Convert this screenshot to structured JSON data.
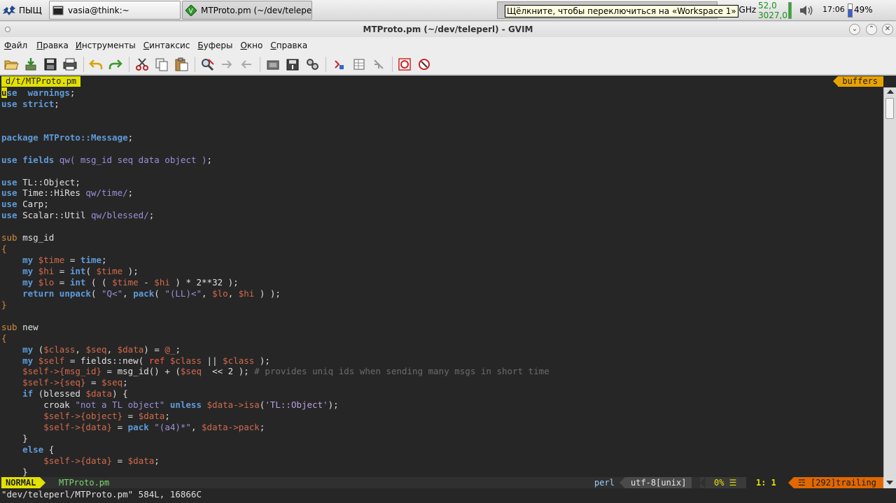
{
  "taskbar": {
    "start_label": "ПЫЩ",
    "tasks": [
      {
        "label": "vasia@think:~"
      },
      {
        "label": "MTProto.pm (~/dev/teleperl..."
      }
    ],
    "tooltip": "Щёлкните, чтобы переключиться на «Workspace 1»",
    "cpu_freq": "2,59 GHz",
    "temp1": "52,0",
    "temp2": "3027,0",
    "clock": "17:06",
    "battery": "49%",
    "battery_level": 0.49
  },
  "window": {
    "title": "MTProto.pm (~/dev/teleperl) - GVIM"
  },
  "menubar": {
    "items": [
      "Файл",
      "Правка",
      "Инструменты",
      "Синтаксис",
      "Буферы",
      "Окно",
      "Справка"
    ]
  },
  "toolbar": {
    "icons": [
      "open-icon",
      "save-icon",
      "save-all-icon",
      "print-icon",
      "undo-icon",
      "redo-icon",
      "cut-icon",
      "copy-icon",
      "paste-icon",
      "find-replace-icon",
      "find-next-icon",
      "find-prev-icon",
      "load-session-icon",
      "save-session-icon",
      "run-script-icon",
      "make-icon",
      "run-ctags-icon",
      "jump-tag-icon",
      "help-icon",
      "find-help-icon"
    ]
  },
  "editor": {
    "tab_file": "d/t/MTProto.pm",
    "tab_buffers": "buffers",
    "lines": [
      [
        [
          "kw",
          "use"
        ],
        [
          "",
          "  "
        ],
        [
          "kw",
          "warnings"
        ],
        [
          "",
          ";"
        ]
      ],
      [
        [
          "kw",
          "use"
        ],
        [
          "",
          ""
        ],
        [
          "kw",
          " strict"
        ],
        [
          "",
          ";"
        ]
      ],
      [],
      [],
      [
        [
          "kw",
          "package"
        ],
        [
          "kw",
          " MTProto::Message"
        ],
        [
          "",
          ";"
        ]
      ],
      [],
      [
        [
          "kw",
          "use"
        ],
        [
          "kw",
          " fields"
        ],
        [
          "",
          " "
        ],
        [
          "str",
          "qw("
        ],
        [
          "str",
          " msg_id seq data object "
        ],
        [
          "str",
          ")"
        ],
        [
          "",
          ";"
        ]
      ],
      [],
      [
        [
          "kw",
          "use"
        ],
        [
          "",
          " TL::Object;"
        ]
      ],
      [
        [
          "kw",
          "use"
        ],
        [
          "",
          " Time::HiRes "
        ],
        [
          "str",
          "qw/time/"
        ],
        [
          "",
          ";"
        ]
      ],
      [
        [
          "kw",
          "use"
        ],
        [
          "",
          " Carp;"
        ]
      ],
      [
        [
          "kw",
          "use"
        ],
        [
          "",
          " Scalar::Util "
        ],
        [
          "str",
          "qw/blessed/"
        ],
        [
          "",
          ";"
        ]
      ],
      [],
      [
        [
          "kw2",
          "sub"
        ],
        [
          "",
          " msg_id"
        ]
      ],
      [
        [
          "kw2",
          "{"
        ]
      ],
      [
        [
          "",
          "    "
        ],
        [
          "kw",
          "my"
        ],
        [
          "",
          " "
        ],
        [
          "var",
          "$time"
        ],
        [
          "",
          " = "
        ],
        [
          "kw",
          "time"
        ],
        [
          "",
          ";"
        ]
      ],
      [
        [
          "",
          "    "
        ],
        [
          "kw",
          "my"
        ],
        [
          "",
          " "
        ],
        [
          "var",
          "$hi"
        ],
        [
          "",
          " = "
        ],
        [
          "kw",
          "int"
        ],
        [
          "",
          "( "
        ],
        [
          "var",
          "$time"
        ],
        [
          "",
          " );"
        ]
      ],
      [
        [
          "",
          "    "
        ],
        [
          "kw",
          "my"
        ],
        [
          "",
          " "
        ],
        [
          "var",
          "$lo"
        ],
        [
          "",
          " = "
        ],
        [
          "kw",
          "int"
        ],
        [
          "",
          " ( ( "
        ],
        [
          "var",
          "$time"
        ],
        [
          "",
          " - "
        ],
        [
          "var",
          "$hi"
        ],
        [
          "",
          " ) * 2**32 );"
        ]
      ],
      [
        [
          "",
          "    "
        ],
        [
          "kw",
          "return"
        ],
        [
          "",
          " "
        ],
        [
          "kw",
          "unpack"
        ],
        [
          "",
          "( "
        ],
        [
          "str",
          "\"Q<\""
        ],
        [
          "",
          ", "
        ],
        [
          "kw",
          "pack"
        ],
        [
          "",
          "( "
        ],
        [
          "str",
          "\"(LL)<\""
        ],
        [
          "",
          ", "
        ],
        [
          "var",
          "$lo"
        ],
        [
          "",
          ", "
        ],
        [
          "var",
          "$hi"
        ],
        [
          "",
          " ) );"
        ]
      ],
      [
        [
          "kw2",
          "}"
        ]
      ],
      [],
      [
        [
          "kw2",
          "sub"
        ],
        [
          "",
          " new"
        ]
      ],
      [
        [
          "kw2",
          "{"
        ]
      ],
      [
        [
          "",
          "    "
        ],
        [
          "kw",
          "my"
        ],
        [
          "",
          " ("
        ],
        [
          "var",
          "$class"
        ],
        [
          "",
          ", "
        ],
        [
          "var",
          "$seq"
        ],
        [
          "",
          ", "
        ],
        [
          "var",
          "$data"
        ],
        [
          "",
          ") = "
        ],
        [
          "var",
          "@_"
        ],
        [
          "",
          ";"
        ]
      ],
      [
        [
          "",
          "    "
        ],
        [
          "kw",
          "my"
        ],
        [
          "",
          " "
        ],
        [
          "var",
          "$self"
        ],
        [
          "",
          " = fields::new( "
        ],
        [
          "sv",
          "ref"
        ],
        [
          "",
          " "
        ],
        [
          "var",
          "$class"
        ],
        [
          "",
          " || "
        ],
        [
          "var",
          "$class"
        ],
        [
          "",
          " );"
        ]
      ],
      [
        [
          "",
          "    "
        ],
        [
          "var",
          "$self->"
        ],
        [
          "var",
          "{msg_id}"
        ],
        [
          "",
          " = msg_id() + ("
        ],
        [
          "var",
          "$seq"
        ],
        [
          "",
          "  << 2 ); "
        ],
        [
          "cm",
          "# provides uniq ids when sending many msgs in short time"
        ]
      ],
      [
        [
          "",
          "    "
        ],
        [
          "var",
          "$self->"
        ],
        [
          "var",
          "{seq}"
        ],
        [
          "",
          " = "
        ],
        [
          "var",
          "$seq"
        ],
        [
          "",
          ";"
        ]
      ],
      [
        [
          "",
          "    "
        ],
        [
          "kw",
          "if"
        ],
        [
          "",
          " (blessed "
        ],
        [
          "var",
          "$data"
        ],
        [
          "",
          ") {"
        ]
      ],
      [
        [
          "",
          "        croak "
        ],
        [
          "str",
          "\"not a TL object\""
        ],
        [
          "",
          " "
        ],
        [
          "kw",
          "unless"
        ],
        [
          "",
          " "
        ],
        [
          "var",
          "$data"
        ],
        [
          "var",
          "->isa"
        ],
        [
          "",
          "("
        ],
        [
          "sq",
          "'TL::Object'"
        ],
        [
          "",
          ");"
        ]
      ],
      [
        [
          "",
          "        "
        ],
        [
          "var",
          "$self->"
        ],
        [
          "var",
          "{object}"
        ],
        [
          "",
          " = "
        ],
        [
          "var",
          "$data"
        ],
        [
          "",
          ";"
        ]
      ],
      [
        [
          "",
          "        "
        ],
        [
          "var",
          "$self->"
        ],
        [
          "var",
          "{data}"
        ],
        [
          "",
          " = "
        ],
        [
          "kw",
          "pack"
        ],
        [
          "",
          " "
        ],
        [
          "str",
          "\"(a4)*\""
        ],
        [
          "",
          ", "
        ],
        [
          "var",
          "$data"
        ],
        [
          "var",
          "->pack"
        ],
        [
          "",
          ";"
        ]
      ],
      [
        [
          "",
          "    }"
        ]
      ],
      [
        [
          "",
          "    "
        ],
        [
          "kw",
          "else"
        ],
        [
          "",
          " {"
        ]
      ],
      [
        [
          "",
          "        "
        ],
        [
          "var",
          "$self->"
        ],
        [
          "var",
          "{data}"
        ],
        [
          "",
          " = "
        ],
        [
          "var",
          "$data"
        ],
        [
          "",
          ";"
        ]
      ],
      [
        [
          "",
          "    }"
        ]
      ]
    ]
  },
  "statusline": {
    "mode": "NORMAL",
    "file": "MTProto.pm",
    "filetype": "perl",
    "encoding": "utf-8[unix]",
    "percent": "0% ☰",
    "position": "1:  1",
    "trailing": "☲ [292]trailing"
  },
  "cmdline": "\"dev/teleperl/MTProto.pm\" 584L, 16866C",
  "colors": {
    "keyword": "#5f9bd9",
    "variable": "#d26a4c",
    "string": "#9b8fd8",
    "comment": "#6c6c6c",
    "mode_bg": "#e2e100",
    "trailing_bg": "#e06800",
    "editor_bg": "#262626"
  }
}
